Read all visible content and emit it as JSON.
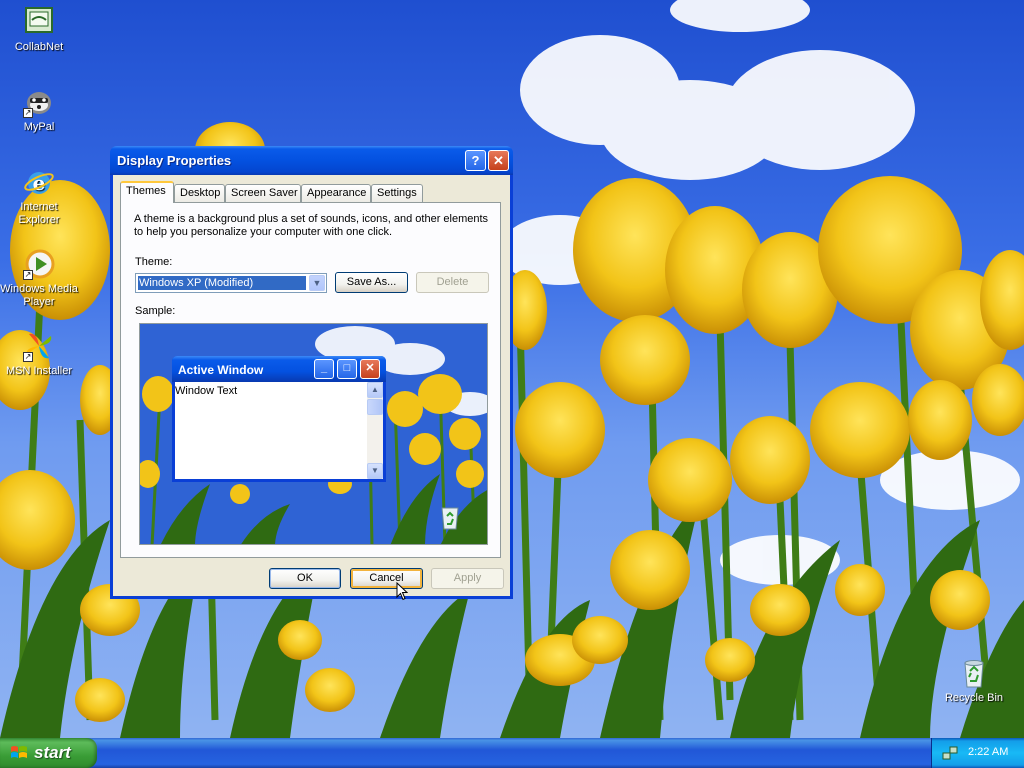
{
  "desktop": {
    "icons": [
      {
        "label": "CollabNet",
        "icon": "collabnet-icon"
      },
      {
        "label": "MyPal",
        "icon": "mypal-icon"
      },
      {
        "label": "Internet Explorer",
        "icon": "internet-explorer-icon"
      },
      {
        "label": "Windows Media Player",
        "icon": "windows-media-player-icon"
      },
      {
        "label": "MSN Installer",
        "icon": "msn-installer-icon"
      },
      {
        "label": "Recycle Bin",
        "icon": "recycle-bin-icon"
      }
    ]
  },
  "window": {
    "title": "Display Properties",
    "help_label": "?",
    "close_label": "✕",
    "tabs": [
      "Themes",
      "Desktop",
      "Screen Saver",
      "Appearance",
      "Settings"
    ],
    "active_tab": "Themes",
    "description": "A theme is a background plus a set of sounds, icons, and other elements to help you personalize your computer with one click.",
    "theme_label": "Theme:",
    "theme_value": "Windows XP (Modified)",
    "save_as_label": "Save As...",
    "delete_label": "Delete",
    "sample_label": "Sample:",
    "sample": {
      "window_title": "Active Window",
      "window_text": "Window Text"
    },
    "ok_label": "OK",
    "cancel_label": "Cancel",
    "apply_label": "Apply"
  },
  "taskbar": {
    "start_label": "start",
    "clock": "2:22 AM"
  },
  "colors": {
    "titlebar": "#0a5bea",
    "start_green": "#3a9d36",
    "tab_highlight": "#ffc83c",
    "selection": "#316ac5"
  }
}
